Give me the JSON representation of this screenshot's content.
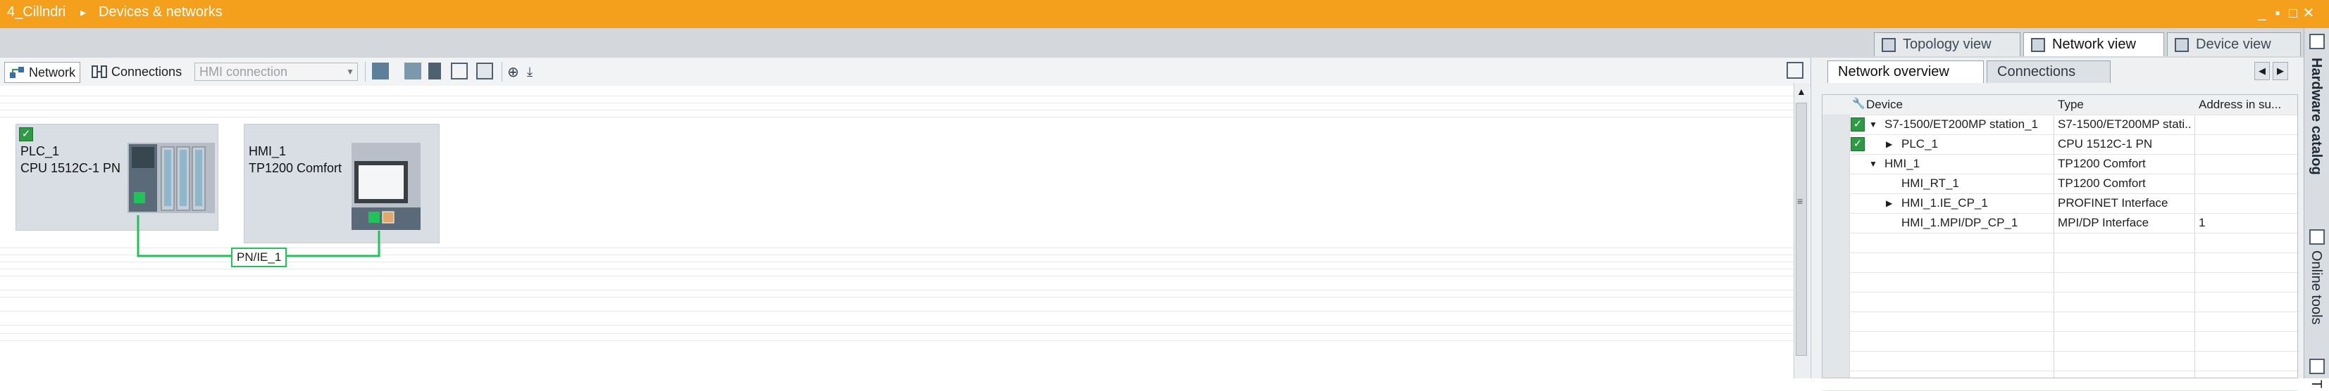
{
  "titlebar": {
    "project": "4_Cillndri",
    "section": "Devices & networks",
    "buttons": [
      "_",
      "▪",
      "□",
      "✕"
    ]
  },
  "view_tabs": [
    {
      "label": "Topology view",
      "active": false
    },
    {
      "label": "Network view",
      "active": true
    },
    {
      "label": "Device view",
      "active": false
    }
  ],
  "toolbar": {
    "network_label": "Network",
    "connections_label": "Connections",
    "connection_type": "HMI connection"
  },
  "devices": [
    {
      "name": "PLC_1",
      "type": "CPU 1512C-1 PN"
    },
    {
      "name": "HMI_1",
      "type": "TP1200 Comfort"
    }
  ],
  "network_label": "PN/IE_1",
  "right_panel": {
    "tabs": [
      {
        "label": "Network overview",
        "active": true
      },
      {
        "label": "Connections",
        "active": false
      }
    ],
    "columns": [
      "Device",
      "Type",
      "Address in su..."
    ],
    "rows": [
      {
        "device": "S7-1500/ET200MP station_1",
        "type": "S7-1500/ET200MP stati...",
        "address": "",
        "level": 0,
        "expand": "▼",
        "checked": true
      },
      {
        "device": "PLC_1",
        "type": "CPU 1512C-1 PN",
        "address": "",
        "level": 1,
        "expand": "▶",
        "checked": true
      },
      {
        "device": "HMI_1",
        "type": "TP1200 Comfort",
        "address": "",
        "level": 0,
        "expand": "▼",
        "checked": false
      },
      {
        "device": "HMI_RT_1",
        "type": "TP1200 Comfort",
        "address": "",
        "level": 1,
        "expand": "",
        "checked": false
      },
      {
        "device": "HMI_1.IE_CP_1",
        "type": "PROFINET Interface",
        "address": "",
        "level": 1,
        "expand": "▶",
        "checked": false
      },
      {
        "device": "HMI_1.MPI/DP_CP_1",
        "type": "MPI/DP Interface",
        "address": "1",
        "level": 1,
        "expand": "",
        "checked": false
      }
    ]
  },
  "side_tabs": [
    "Hardware catalog",
    "Online tools",
    "T"
  ]
}
